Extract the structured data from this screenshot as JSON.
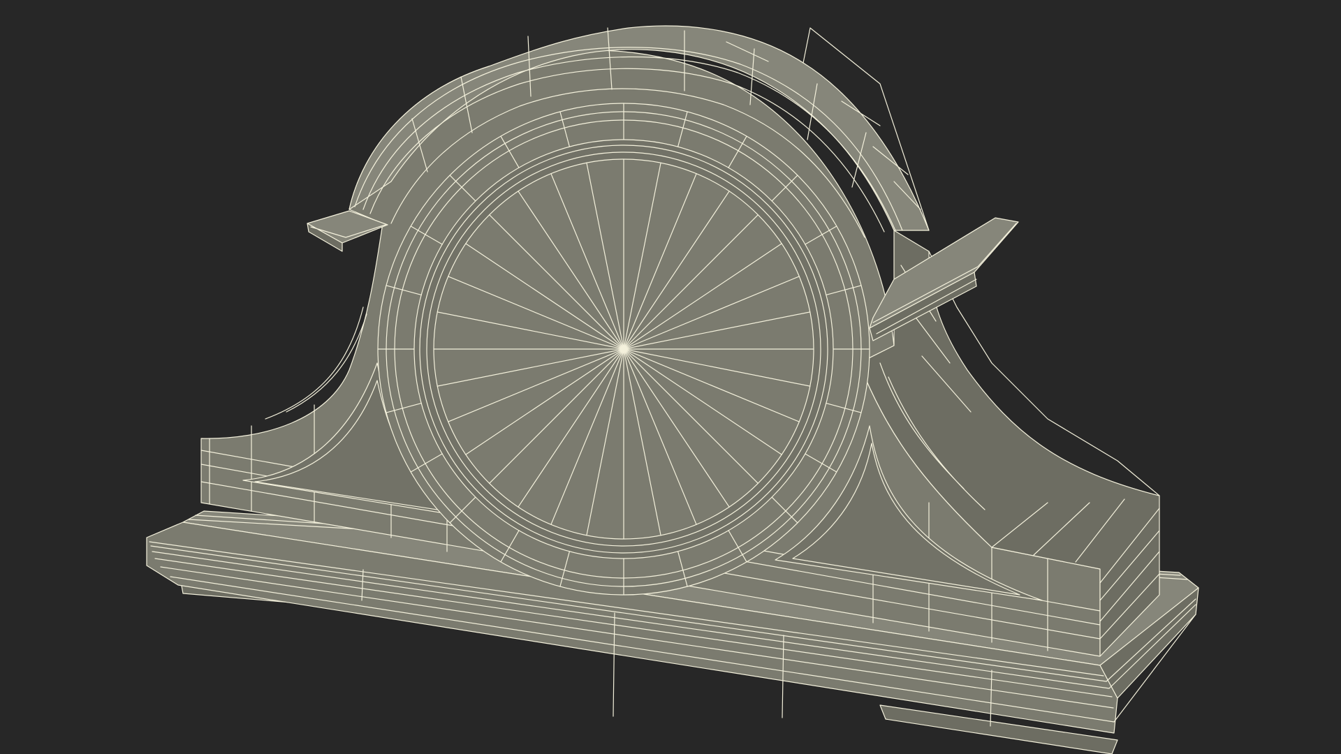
{
  "scene": {
    "subject": "mantel-clock-wireframe",
    "background_color": "#272727",
    "surface_color": "#7b7b6f",
    "surface_shadow_color": "#6d6d62",
    "surface_light_color": "#86867a",
    "wire_color": "#f4f1dc"
  }
}
